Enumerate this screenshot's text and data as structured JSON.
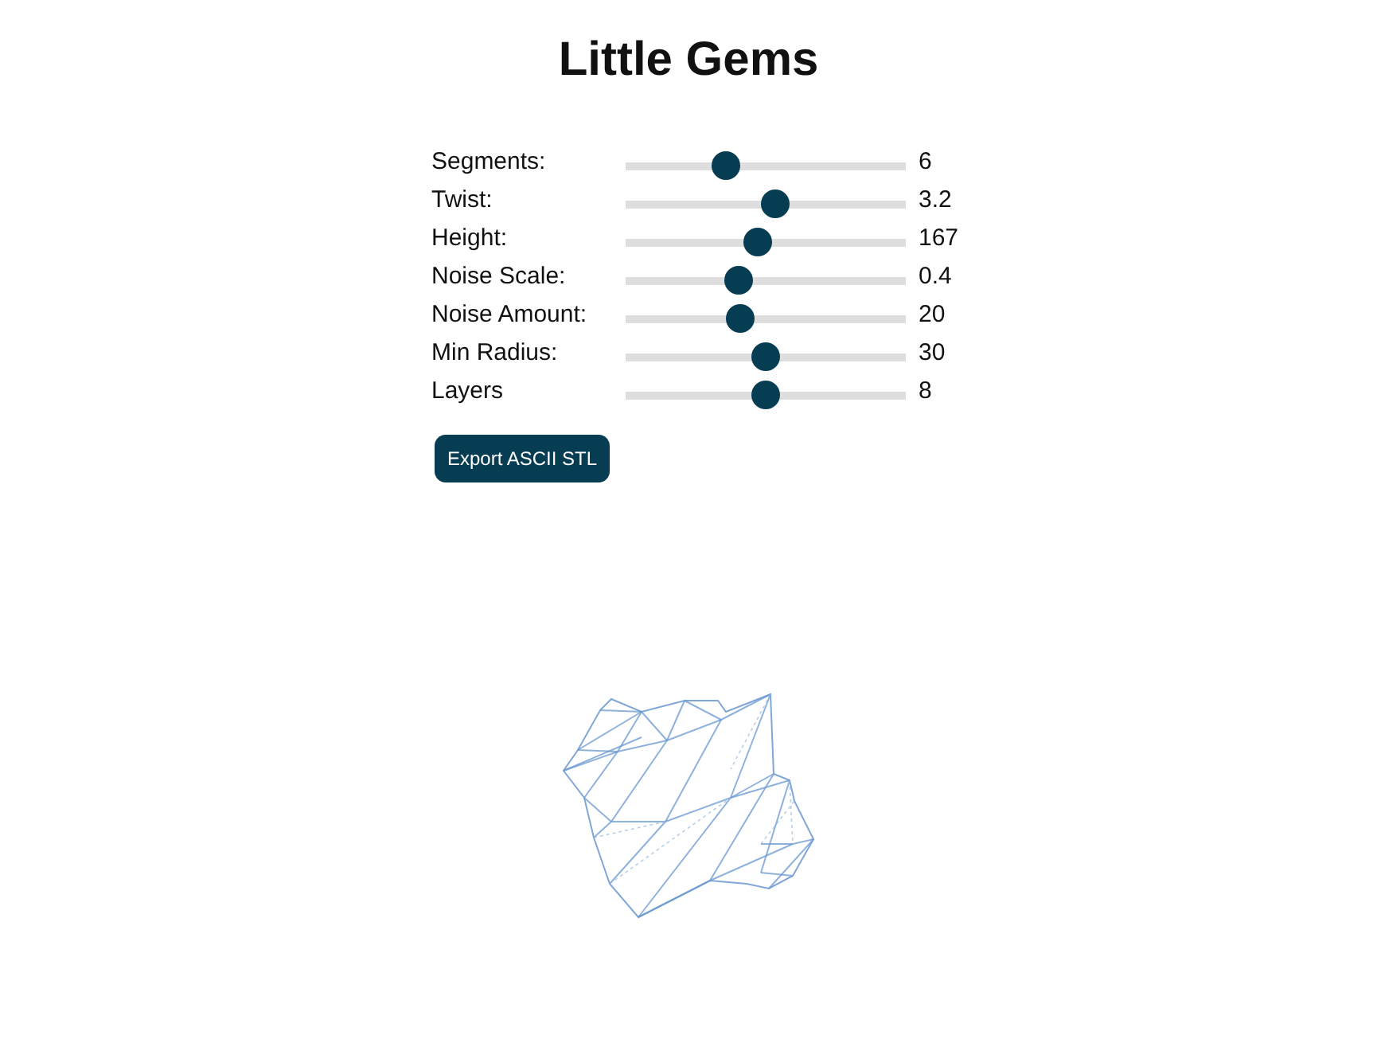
{
  "title": "Little Gems",
  "sliders": [
    {
      "label": "Segments:",
      "level": 0.34,
      "reading": "6"
    },
    {
      "label": "Twist:",
      "level": 0.54,
      "reading": "3.2"
    },
    {
      "label": "Height:",
      "level": 0.47,
      "reading": "167"
    },
    {
      "label": "Noise Scale:",
      "level": 0.39,
      "reading": "0.4"
    },
    {
      "label": "Noise Amount:",
      "level": 0.4,
      "reading": "20"
    },
    {
      "label": "Min Radius:",
      "level": 0.5,
      "reading": "30"
    },
    {
      "label": "Layers",
      "level": 0.5,
      "reading": "8"
    }
  ],
  "export_button": {
    "label": "Export ASCII STL"
  }
}
